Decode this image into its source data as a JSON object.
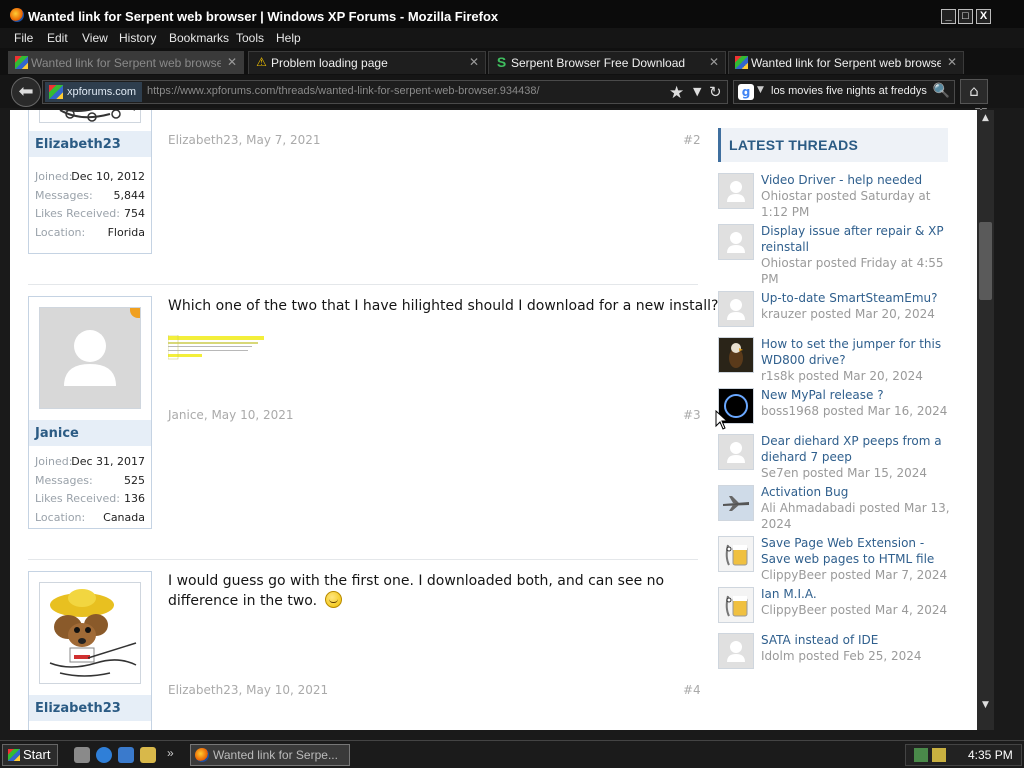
{
  "window": {
    "title": "Wanted link for Serpent web browser | Windows XP Forums - Mozilla Firefox",
    "controls": {
      "minimize": "_",
      "maximize": "□",
      "close": "X"
    }
  },
  "menu": [
    "File",
    "Edit",
    "View",
    "History",
    "Bookmarks",
    "Tools",
    "Help"
  ],
  "tabs": [
    {
      "label": "Wanted link for Serpent web browser |...",
      "icon": "xp-favicon",
      "active": true
    },
    {
      "label": "Problem loading page",
      "icon": "warning-icon",
      "active": false
    },
    {
      "label": "Serpent Browser Free Download",
      "icon": "serpent-s-icon",
      "active": false
    },
    {
      "label": "Wanted link for Serpent web browser |...",
      "icon": "xp-favicon",
      "active": false
    }
  ],
  "nav": {
    "site_badge": "xpforums.com",
    "url": "https://www.xpforums.com/threads/wanted-link-for-serpent-web-browser.934438/",
    "search_query": "los movies five nights at freddys"
  },
  "posts": [
    {
      "author": "Elizabeth23",
      "meta": "Elizabeth23, May 7, 2021",
      "num": "#2",
      "stats": [
        {
          "label": "Joined:",
          "value": "Dec 10, 2012"
        },
        {
          "label": "Messages:",
          "value": "5,844"
        },
        {
          "label": "Likes Received:",
          "value": "754"
        },
        {
          "label": "Location:",
          "value": "Florida"
        }
      ]
    },
    {
      "author": "Janice",
      "text": "Which one of the two that I have hilighted should I download for a new install?",
      "meta": "Janice, May 10, 2021",
      "num": "#3",
      "stats": [
        {
          "label": "Joined:",
          "value": "Dec 31, 2017"
        },
        {
          "label": "Messages:",
          "value": "525"
        },
        {
          "label": "Likes Received:",
          "value": "136"
        },
        {
          "label": "Location:",
          "value": "Canada"
        }
      ]
    },
    {
      "author": "Elizabeth23",
      "text": "I would guess go with the first one. I downloaded both, and can see no difference in the two.",
      "meta": "Elizabeth23, May 10, 2021",
      "num": "#4"
    }
  ],
  "sidebar": {
    "heading": "LATEST THREADS",
    "threads": [
      {
        "title": "Video Driver - help needed",
        "meta": "Ohiostar posted Saturday at 1:12 PM",
        "avatar": "default"
      },
      {
        "title": "Display issue after repair & XP reinstall",
        "meta": "Ohiostar posted Friday at 4:55 PM",
        "avatar": "default"
      },
      {
        "title": "Up-to-date SmartSteamEmu?",
        "meta": "krauzer posted Mar 20, 2024",
        "avatar": "default"
      },
      {
        "title": "How to set the jumper for this WD800 drive?",
        "meta": "r1s8k posted Mar 20, 2024",
        "avatar": "eagle"
      },
      {
        "title": "New MyPal release ?",
        "meta": "boss1968 posted Mar 16, 2024",
        "avatar": "eclipse"
      },
      {
        "title": "Dear diehard XP peeps from a diehard 7 peep",
        "meta": "Se7en posted Mar 15, 2024",
        "avatar": "default"
      },
      {
        "title": "Activation Bug",
        "meta": "Ali Ahmadabadi posted Mar 13, 2024",
        "avatar": "plane"
      },
      {
        "title": "Save Page Web Extension - Save web pages to HTML file",
        "meta": "ClippyBeer posted Mar 7, 2024",
        "avatar": "clippy"
      },
      {
        "title": "Ian M.I.A.",
        "meta": "ClippyBeer posted Mar 4, 2024",
        "avatar": "clippy"
      },
      {
        "title": "SATA instead of IDE",
        "meta": "Idolm posted Feb 25, 2024",
        "avatar": "default"
      }
    ]
  },
  "taskbar": {
    "start": "Start",
    "task": "Wanted link for Serpe...",
    "clock": "4:35 PM"
  }
}
